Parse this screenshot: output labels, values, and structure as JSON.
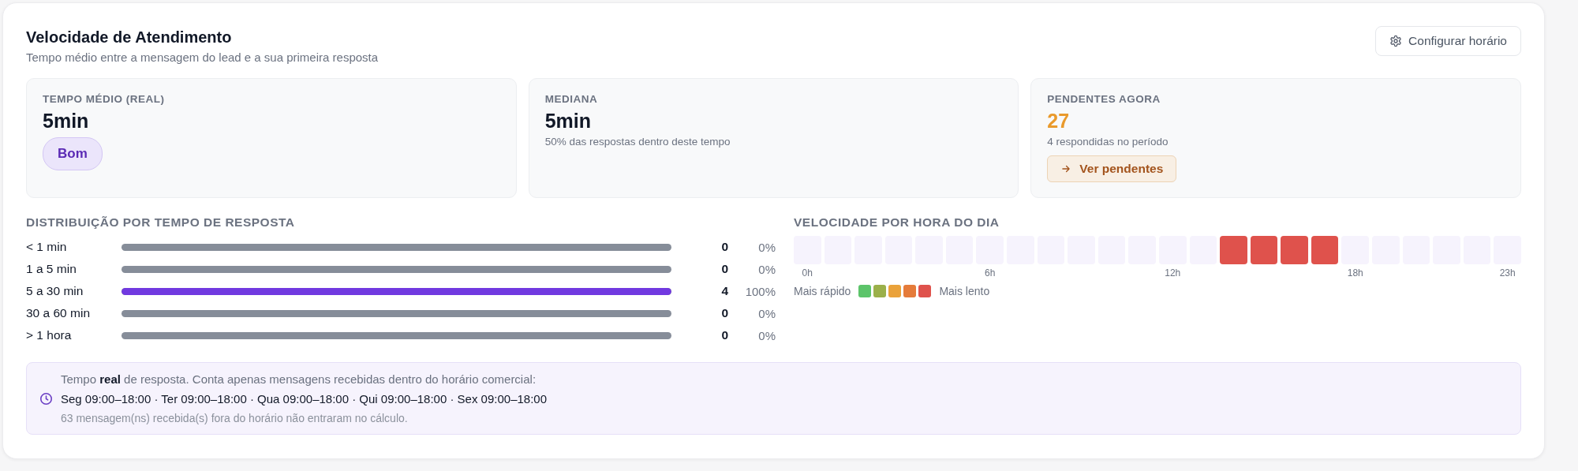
{
  "header": {
    "title": "Velocidade de Atendimento",
    "subtitle": "Tempo médio entre a mensagem do lead e a sua primeira resposta",
    "button": "Configurar horário"
  },
  "cards": [
    {
      "kind": "badge",
      "label": "TEMPO MÉDIO (REAL)",
      "value": "5min",
      "badge": "Bom"
    },
    {
      "kind": "note",
      "label": "MEDIANA",
      "value": "5min",
      "note": "50% das respostas dentro deste tempo"
    },
    {
      "kind": "action",
      "label": "PENDENTES AGORA",
      "value": "27",
      "note": "4 respondidas no período",
      "action": "Ver pendentes"
    }
  ],
  "distribution": {
    "title": "DISTRIBUIÇÃO POR TEMPO DE RESPOSTA",
    "rows": [
      {
        "label": "< 1 min",
        "level": 0,
        "count": "0",
        "percent": "0%"
      },
      {
        "label": "1 a 5 min",
        "level": 0,
        "count": "0",
        "percent": "0%"
      },
      {
        "label": "5 a 30 min",
        "level": 1,
        "count": "4",
        "percent": "100%"
      },
      {
        "label": "30 a 60 min",
        "level": 0,
        "count": "0",
        "percent": "0%"
      },
      {
        "label": "> 1 hora",
        "level": 0,
        "count": "0",
        "percent": "0%"
      }
    ]
  },
  "hourly": {
    "title": "VELOCIDADE POR HORA DO DIA",
    "hours": [
      {
        "color": "#f6f3fd",
        "label": "0h"
      },
      {
        "color": "#f6f3fd"
      },
      {
        "color": "#f6f3fd"
      },
      {
        "color": "#f6f3fd"
      },
      {
        "color": "#f6f3fd"
      },
      {
        "color": "#f6f3fd"
      },
      {
        "color": "#f6f3fd",
        "label": "6h"
      },
      {
        "color": "#f6f3fd"
      },
      {
        "color": "#f6f3fd"
      },
      {
        "color": "#f6f3fd"
      },
      {
        "color": "#f6f3fd"
      },
      {
        "color": "#f6f3fd"
      },
      {
        "color": "#f6f3fd",
        "label": "12h"
      },
      {
        "color": "#f6f3fd"
      },
      {
        "color": "#df524c"
      },
      {
        "color": "#df524c"
      },
      {
        "color": "#df524c"
      },
      {
        "color": "#df524c"
      },
      {
        "color": "#f6f3fd",
        "label": "18h"
      },
      {
        "color": "#f6f3fd"
      },
      {
        "color": "#f6f3fd"
      },
      {
        "color": "#f6f3fd"
      },
      {
        "color": "#f6f3fd"
      },
      {
        "color": "#f6f3fd",
        "label": "23h"
      }
    ],
    "legend": {
      "fast": "Mais rápido",
      "slow": "Mais lento",
      "swatches": [
        {
          "color": "#5cc46a"
        },
        {
          "color": "#9bb04a"
        },
        {
          "color": "#eaa23a"
        },
        {
          "color": "#e57b3a"
        },
        {
          "color": "#df524c"
        }
      ]
    }
  },
  "footer": {
    "intro": "Tempo **real** de resposta. Conta apenas mensagens recebidas dentro do horário comercial:",
    "schedule": "Seg 09:00–18:00 · Ter 09:00–18:00 · Qua 09:00–18:00 · Qui 09:00–18:00 · Sex 09:00–18:00",
    "note": "63 mensagem(ns) recebida(s) fora do horário não entraram no cálculo."
  }
}
